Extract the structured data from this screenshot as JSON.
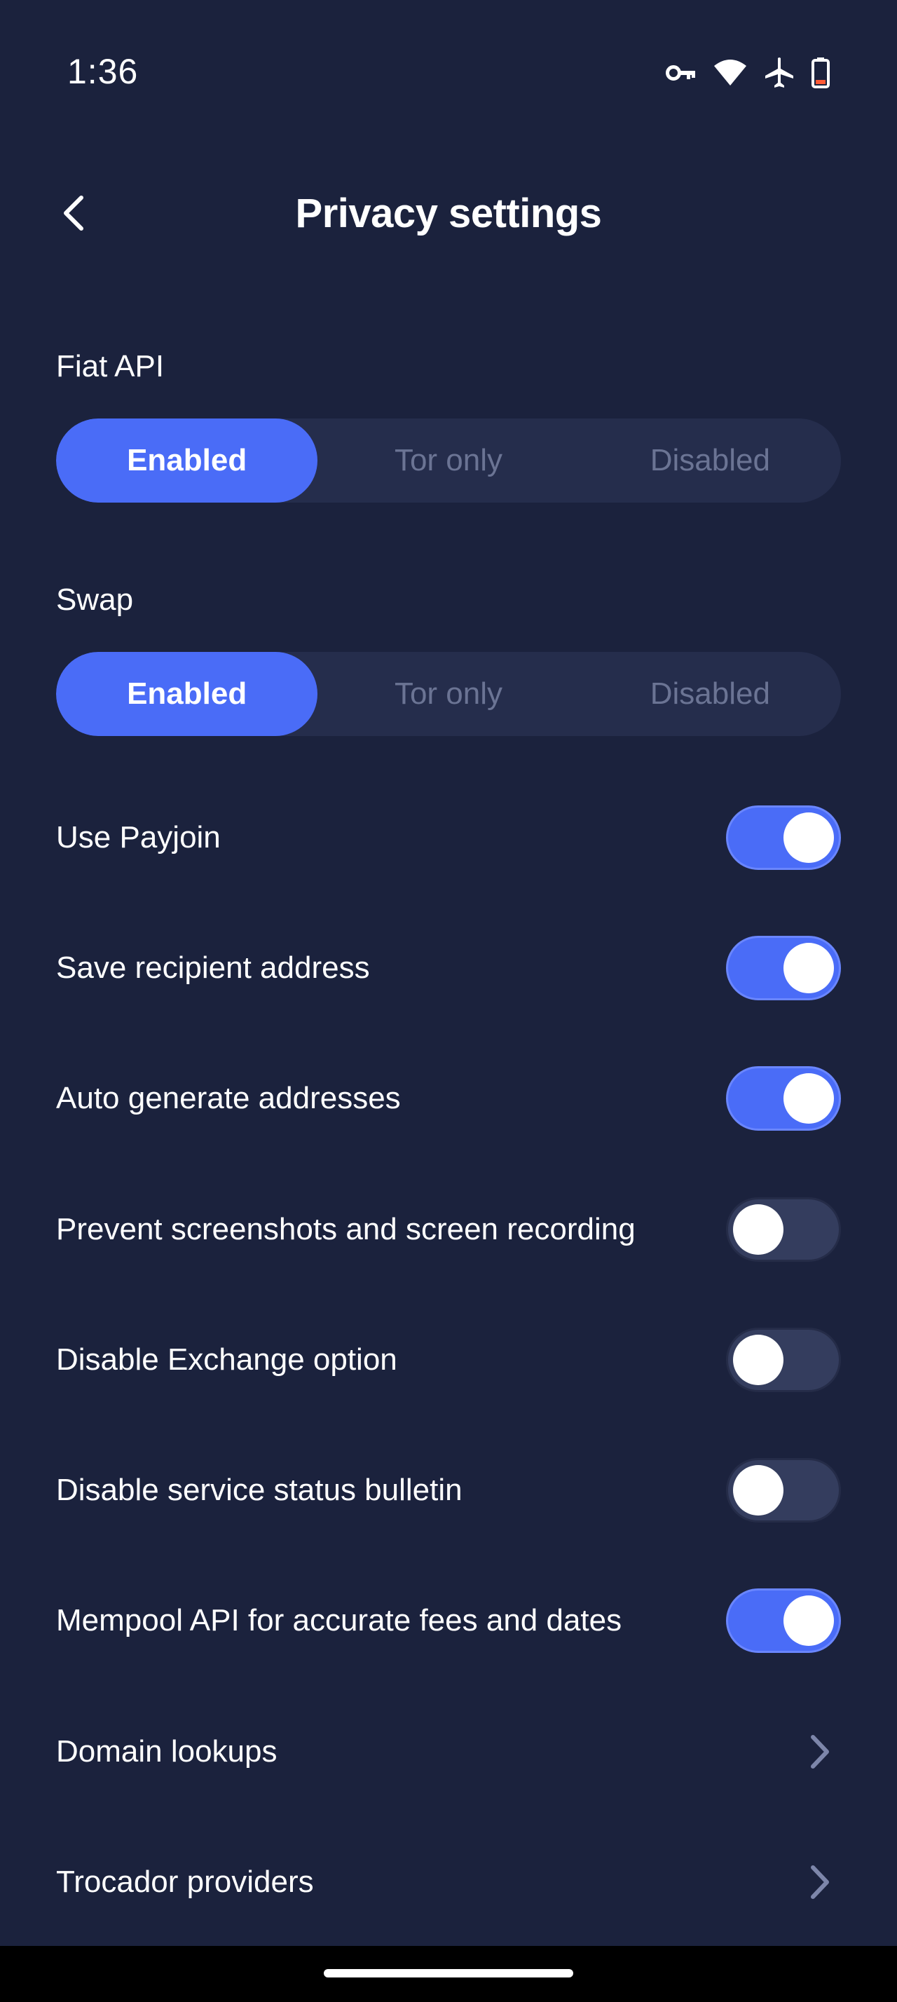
{
  "status_bar": {
    "time": "1:36",
    "icons": [
      "vpn-key-icon",
      "wifi-icon",
      "airplane-mode-icon",
      "battery-low-icon"
    ],
    "battery_warning_color": "#ff5a36"
  },
  "header": {
    "title": "Privacy settings",
    "back_icon": "chevron-left-icon"
  },
  "fiat_api": {
    "label": "Fiat API",
    "options": [
      "Enabled",
      "Tor only",
      "Disabled"
    ],
    "selected": "Enabled"
  },
  "swap": {
    "label": "Swap",
    "options": [
      "Enabled",
      "Tor only",
      "Disabled"
    ],
    "selected": "Enabled"
  },
  "toggles": [
    {
      "label": "Use Payjoin",
      "on": true
    },
    {
      "label": "Save recipient address",
      "on": true
    },
    {
      "label": "Auto generate addresses",
      "on": true
    },
    {
      "label": "Prevent screenshots and screen recording",
      "on": false
    },
    {
      "label": "Disable Exchange option",
      "on": false
    },
    {
      "label": "Disable service status bulletin",
      "on": false
    },
    {
      "label": "Mempool API for accurate fees and dates",
      "on": true
    }
  ],
  "links": [
    {
      "label": "Domain lookups",
      "icon": "chevron-right-icon"
    },
    {
      "label": "Trocador providers",
      "icon": "chevron-right-icon"
    }
  ],
  "colors": {
    "background": "#1b223d",
    "accent": "#4a6cf7",
    "segment_track": "#252d4c",
    "inactive_text": "#6b7494",
    "toggle_off_track": "#343d5e"
  }
}
